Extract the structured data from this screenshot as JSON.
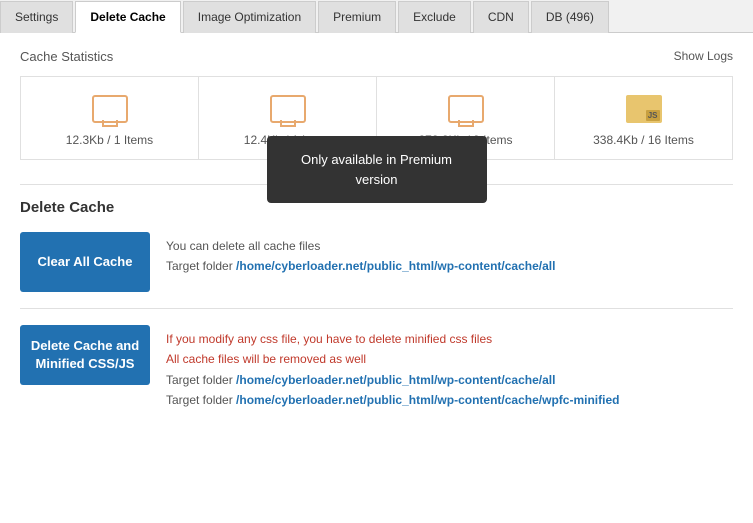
{
  "tabs": [
    {
      "label": "Settings",
      "active": false
    },
    {
      "label": "Delete Cache",
      "active": true
    },
    {
      "label": "Image Optimization",
      "active": false
    },
    {
      "label": "Premium",
      "active": false
    },
    {
      "label": "Exclude",
      "active": false
    },
    {
      "label": "CDN",
      "active": false
    },
    {
      "label": "DB (496)",
      "active": false
    }
  ],
  "show_logs": "Show Logs",
  "cache_statistics": {
    "title": "Cache Statistics",
    "tooltip": "Only available in Premium version",
    "cards": [
      {
        "value": "12.3Kb / 1 Items",
        "icon": "monitor"
      },
      {
        "value": "12.4Kb / 1 Items",
        "icon": "monitor"
      },
      {
        "value": "278.2Kb / 9 Items",
        "icon": "monitor"
      },
      {
        "value": "338.4Kb / 16 Items",
        "icon": "js"
      }
    ]
  },
  "delete_cache": {
    "title": "Delete Cache",
    "clear_all": {
      "button": "Clear All Cache",
      "desc": "You can delete all cache files",
      "path_label": "Target folder ",
      "path": "/home/cyberloader.net/public_html/wp-content/cache/all"
    },
    "delete_css": {
      "button_line1": "Delete Cache and",
      "button_line2": "Minified CSS/JS",
      "warning1": "If you modify any css file, you have to delete minified css files",
      "warning2": "All cache files will be removed as well",
      "path1_label": "Target folder ",
      "path1": "/home/cyberloader.net/public_html/wp-content/cache/all",
      "path2_label": "Target folder ",
      "path2": "/home/cyberloader.net/public_html/wp-content/cache/wpfc-minified"
    }
  }
}
